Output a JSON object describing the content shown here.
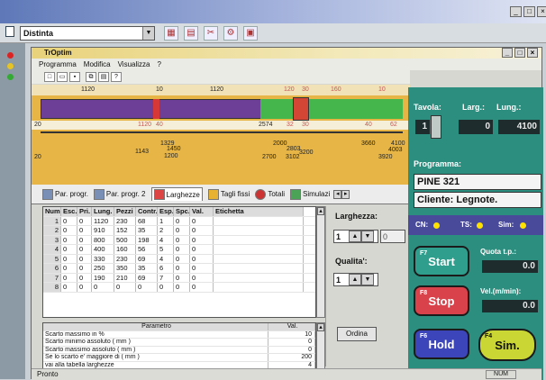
{
  "outer": {
    "combo_value": "Distinta",
    "window_controls": [
      "_",
      "□",
      "×"
    ]
  },
  "window": {
    "title": "TrOptim",
    "controls": [
      "_",
      "□",
      "×"
    ]
  },
  "menu": [
    "Programma",
    "Modifica",
    "Visualizza",
    "?"
  ],
  "graphic": {
    "top_labels": [
      "1120",
      "10",
      "1120",
      "120",
      "30",
      "160",
      "10"
    ],
    "bar_labels": [
      "20",
      "1120",
      "40",
      "2574",
      "32",
      "30",
      "40",
      "62"
    ],
    "bottom_labels": [
      "1143",
      "1329",
      "1450",
      "1200",
      "2000",
      "2803",
      "3200",
      "3660",
      "3102",
      "4100",
      "4003",
      "3920",
      "20",
      "2700"
    ]
  },
  "tabs": [
    "Par. progr.",
    "Par. progr. 2",
    "Larghezze",
    "Tagli fissi",
    "Totali",
    "Simulazi"
  ],
  "grid": {
    "headers": [
      "Num",
      "Esc.",
      "Pri.",
      "Lung.",
      "Pezzi",
      "Contr.",
      "Esp.",
      "Spc.",
      "Val.",
      "Etichetta"
    ],
    "rows": [
      [
        "1",
        "0",
        "0",
        "1120",
        "230",
        "68",
        "1",
        "0",
        "0",
        ""
      ],
      [
        "2",
        "0",
        "0",
        "910",
        "152",
        "35",
        "2",
        "0",
        "0",
        ""
      ],
      [
        "3",
        "0",
        "0",
        "800",
        "500",
        "198",
        "4",
        "0",
        "0",
        ""
      ],
      [
        "4",
        "0",
        "0",
        "400",
        "160",
        "56",
        "5",
        "0",
        "0",
        ""
      ],
      [
        "5",
        "0",
        "0",
        "330",
        "230",
        "69",
        "4",
        "0",
        "0",
        ""
      ],
      [
        "6",
        "0",
        "0",
        "250",
        "350",
        "35",
        "6",
        "0",
        "0",
        ""
      ],
      [
        "7",
        "0",
        "0",
        "190",
        "210",
        "69",
        "7",
        "0",
        "0",
        ""
      ],
      [
        "8",
        "0",
        "0",
        "0",
        "0",
        "0",
        "0",
        "0",
        "0",
        ""
      ]
    ]
  },
  "params": {
    "headers": [
      "Parametro",
      "Val."
    ],
    "rows": [
      [
        "Scarto massimo in %",
        "10"
      ],
      [
        "Scarto minimo assoluto ( mm )",
        "0"
      ],
      [
        "Scarto massimo assoluto ( mm )",
        "0"
      ],
      [
        "Se lo scarto e' maggiore di ( mm )",
        "200"
      ],
      [
        "vai alla tabella larghezze",
        "4"
      ],
      [
        "e alla tabella qualita'",
        "3"
      ]
    ]
  },
  "side": {
    "larghezza_label": "Larghezza:",
    "larghezza_value": "1",
    "larghezza_extra": "0",
    "qualita_label": "Qualita':",
    "qualita_value": "1",
    "ordina_label": "Ordina"
  },
  "panel": {
    "tavola_label": "Tavola:",
    "larg_label": "Larg.:",
    "lung_label": "Lung.:",
    "tavola_value": "1",
    "larg_value": "0",
    "lung_value": "4100",
    "programma_label": "Programma:",
    "programma_value": "PINE 321",
    "cliente_value": "Cliente: Legnote.",
    "indicators": [
      "CN:",
      "TS:",
      "Sim:"
    ],
    "start_fn": "F7",
    "start_label": "Start",
    "stop_fn": "F8",
    "stop_label": "Stop",
    "hold_fn": "F6",
    "hold_label": "Hold",
    "sim_fn": "F4",
    "sim_label": "Sim.",
    "quota_label": "Quota t.p.:",
    "quota_value": "0.0",
    "vel_label": "Vel.(m/min):",
    "vel_value": "0.0"
  },
  "status": {
    "text": "Pronto",
    "num": "NUM"
  }
}
